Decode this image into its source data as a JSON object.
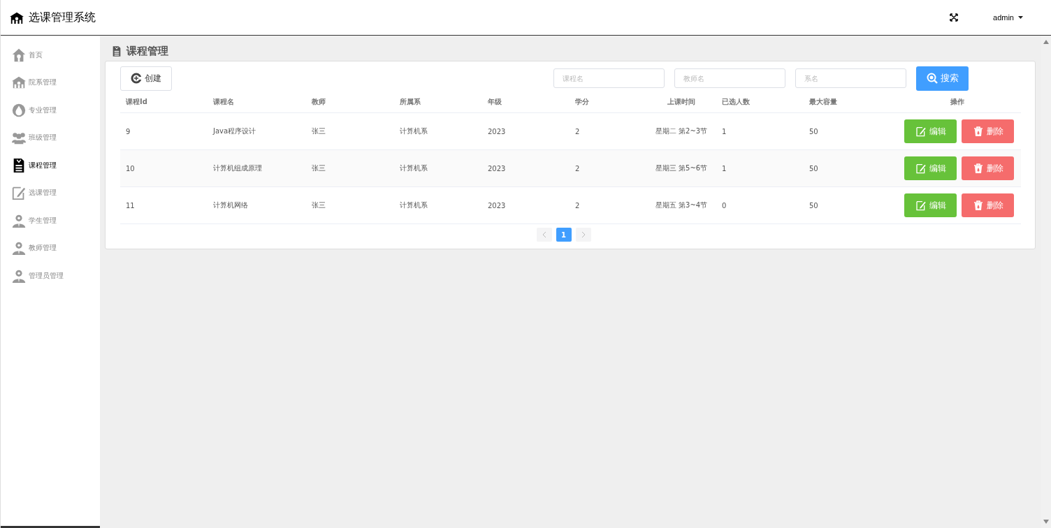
{
  "header": {
    "title": "选课管理系统",
    "user": "admin"
  },
  "sidebar": {
    "items": [
      {
        "label": "首页",
        "kind": "home",
        "selected": false
      },
      {
        "label": "院系管理",
        "kind": "building",
        "selected": false
      },
      {
        "label": "专业管理",
        "kind": "drop",
        "selected": false
      },
      {
        "label": "班级管理",
        "kind": "group",
        "selected": false
      },
      {
        "label": "课程管理",
        "kind": "doc",
        "selected": true
      },
      {
        "label": "选课管理",
        "kind": "edit",
        "selected": false
      },
      {
        "label": "学生管理",
        "kind": "user",
        "selected": false
      },
      {
        "label": "教师管理",
        "kind": "user",
        "selected": false
      },
      {
        "label": "管理员管理",
        "kind": "user",
        "selected": false
      }
    ]
  },
  "page_title": "课程管理",
  "toolbar": {
    "create": "创建",
    "filters": [
      {
        "placeholder": "课程名"
      },
      {
        "placeholder": "教师名"
      },
      {
        "placeholder": "系名"
      }
    ],
    "search": "搜索"
  },
  "table": {
    "columns": [
      "课程Id",
      "课程名",
      "教师",
      "所属系",
      "年级",
      "学分",
      "上课时间",
      "已选人数",
      "最大容量",
      "操作"
    ],
    "rows": [
      {
        "cells": [
          "9",
          "Java程序设计",
          "张三",
          "计算机系",
          "2023",
          "2",
          "星期二 第2~3节",
          "1",
          "50"
        ],
        "actions": [
          "编辑",
          "删除"
        ]
      },
      {
        "cells": [
          "10",
          "计算机组成原理",
          "张三",
          "计算机系",
          "2023",
          "2",
          "星期三 第5~6节",
          "1",
          "50"
        ],
        "actions": [
          "编辑",
          "删除"
        ]
      },
      {
        "cells": [
          "11",
          "计算机网络",
          "张三",
          "计算机系",
          "2023",
          "2",
          "星期五 第3~4节",
          "0",
          "50"
        ],
        "actions": [
          "编辑",
          "删除"
        ]
      }
    ]
  },
  "pagination": {
    "pages": [
      {
        "label": "1",
        "selected": true
      }
    ]
  }
}
